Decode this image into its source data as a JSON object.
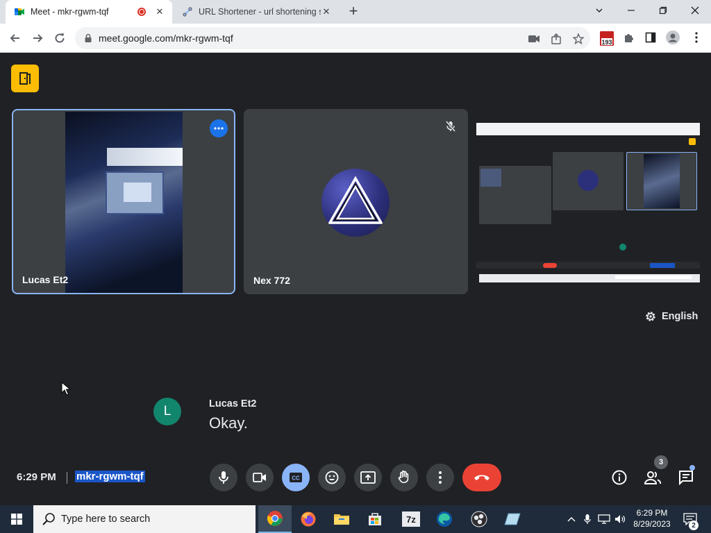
{
  "browser": {
    "tabs": [
      {
        "title": "Meet - mkr-rgwm-tqf",
        "active": true,
        "recording": true
      },
      {
        "title": "URL Shortener - url shortening se",
        "active": false
      }
    ],
    "url": "meet.google.com/mkr-rgwm-tqf",
    "extension_badge": "193"
  },
  "meet": {
    "participants": [
      {
        "name": "Lucas Et2",
        "video": true,
        "pinned": true
      },
      {
        "name": "Nex 772",
        "video": false,
        "muted": true
      },
      {
        "name": "",
        "presentation": true
      }
    ],
    "language_label": "English",
    "caption": {
      "speaker_initial": "L",
      "speaker": "Lucas Et2",
      "text": "Okay."
    },
    "time": "6:29 PM",
    "meeting_code": "mkr-rgwm-tqf",
    "people_count": "3"
  },
  "taskbar": {
    "search_placeholder": "Type here to search",
    "clock_time": "6:29 PM",
    "clock_date": "8/29/2023",
    "notification_count": "2"
  },
  "colors": {
    "meet_bg": "#202124",
    "tile_bg": "#3c4043",
    "accent_blue": "#8ab4f8",
    "end_call_red": "#ea4335",
    "meet_yellow": "#fbbc04",
    "avatar_green": "#12856d"
  }
}
